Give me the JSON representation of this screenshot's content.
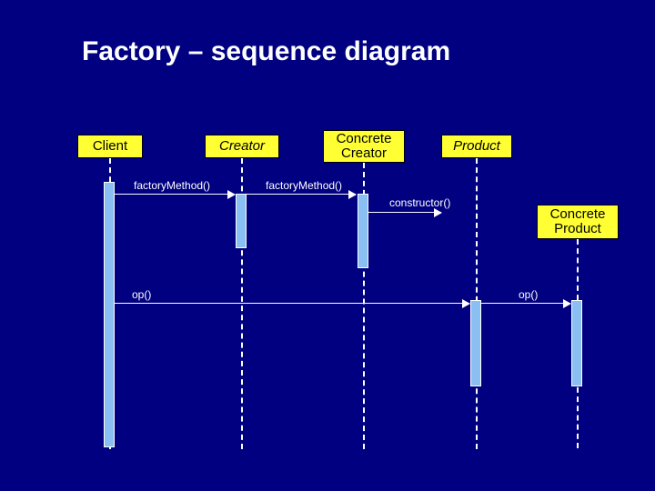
{
  "title": "Factory – sequence diagram",
  "participants": {
    "client": "Client",
    "creator": "Creator",
    "concrete_creator": "Concrete Creator",
    "product": "Product",
    "concrete_product": "Concrete Product"
  },
  "messages": {
    "m1": "factoryMethod()",
    "m2": "factoryMethod()",
    "m3": "constructor()",
    "m4": "op()",
    "m5": "op()"
  },
  "chart_data": {
    "type": "sequence-diagram",
    "title": "Factory – sequence diagram",
    "participants": [
      {
        "id": "client",
        "name": "Client"
      },
      {
        "id": "creator",
        "name": "Creator",
        "abstract": true
      },
      {
        "id": "concrete_creator",
        "name": "Concrete Creator"
      },
      {
        "id": "product",
        "name": "Product",
        "abstract": true
      },
      {
        "id": "concrete_product",
        "name": "Concrete Product"
      }
    ],
    "messages": [
      {
        "from": "client",
        "to": "creator",
        "label": "factoryMethod()"
      },
      {
        "from": "creator",
        "to": "concrete_creator",
        "label": "factoryMethod()"
      },
      {
        "from": "concrete_creator",
        "to": "product",
        "label": "constructor()"
      },
      {
        "from": "client",
        "to": "product",
        "label": "op()"
      },
      {
        "from": "product",
        "to": "concrete_product",
        "label": "op()"
      }
    ]
  }
}
